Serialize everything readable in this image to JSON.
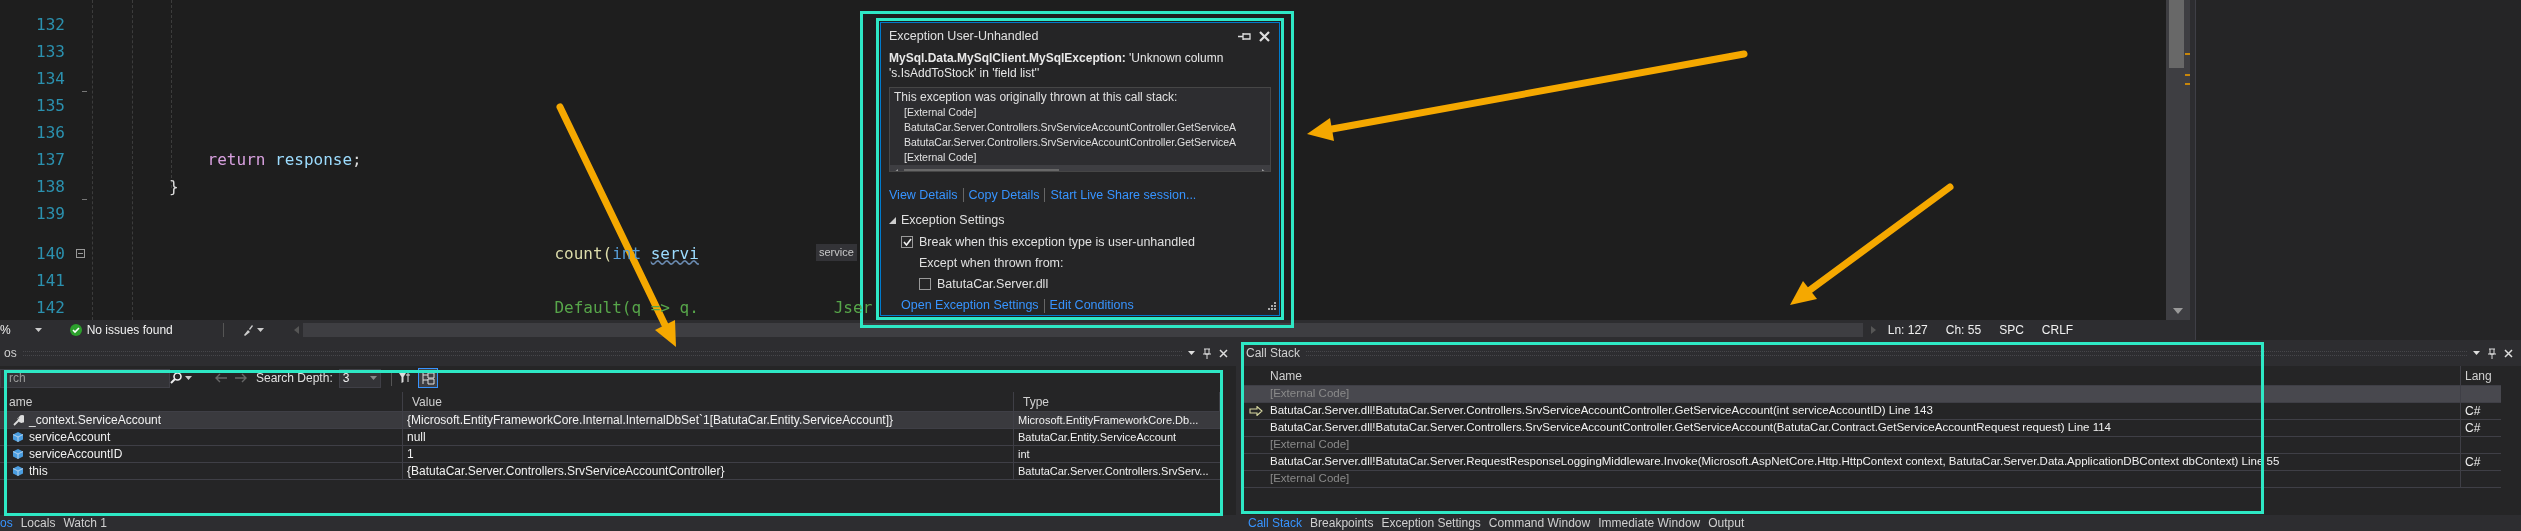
{
  "editor": {
    "lines": [
      {
        "number": "132",
        "kind": "plain"
      },
      {
        "number": "133",
        "kind": "plain"
      },
      {
        "number": "134",
        "kind": "fold_end"
      },
      {
        "number": "135",
        "kind": "plain"
      },
      {
        "number": "136",
        "kind": "plain"
      },
      {
        "number": "137",
        "kind": "plain",
        "tokens": [
          {
            "text": "            return",
            "kind": "control"
          },
          {
            "text": " response",
            "kind": "variable"
          },
          {
            "text": ";",
            "kind": "plain"
          }
        ]
      },
      {
        "number": "138",
        "kind": "fold_end",
        "tokens": [
          {
            "text": "        }",
            "kind": "plain"
          }
        ]
      },
      {
        "number": "139",
        "kind": "plain"
      },
      {
        "number": "140",
        "kind": "fold_start",
        "hint": "service",
        "tokens": [
          {
            "text": "                                                count(",
            "kind": "method"
          },
          {
            "text": "int ",
            "kind": "keyword"
          },
          {
            "text": "servi",
            "kind": "unresolved"
          }
        ]
      },
      {
        "number": "141",
        "kind": "plain"
      },
      {
        "number": "142",
        "kind": "plain",
        "tokens": [
          {
            "text": "                                                Default(q => q.              Jser",
            "kind": "comment"
          }
        ]
      }
    ]
  },
  "editor_status": {
    "zoom": "%",
    "issues": "No issues found",
    "position": [
      "Ln: 127",
      "Ch: 55",
      "SPC",
      "CRLF"
    ]
  },
  "exception_popup": {
    "title": "Exception User-Unhandled",
    "message": "**MySql.Data.MySqlClient.MySqlException:** 'Unknown column 's.IsAddToStock' in 'field list''",
    "stack_intro": "This exception was originally thrown at this call stack:",
    "stack": [
      "[External Code]",
      "BatutaCar.Server.Controllers.SrvServiceAccountController.GetServiceA",
      "BatutaCar.Server.Controllers.SrvServiceAccountController.GetServiceA",
      "[External Code]"
    ],
    "links": [
      "View Details",
      "Copy Details",
      "Start Live Share session..."
    ],
    "settings": {
      "title": "Exception Settings",
      "expanded": true,
      "break_option": {
        "label": "Break when this exception type is user-unhandled",
        "checked": true
      },
      "except_label": "Except when thrown from:",
      "modules": [
        {
          "label": "BatutaCar.Server.dll",
          "checked": false
        }
      ],
      "links": [
        "Open Exception Settings",
        "Edit Conditions"
      ]
    }
  },
  "autos_panel": {
    "title": "os",
    "search": {
      "placeholder": "rch"
    },
    "search_depth_label": "Search Depth:",
    "search_depth": "3",
    "columns": [
      "ame",
      "Value",
      "Type"
    ],
    "rows": [
      {
        "name": "_context.ServiceAccount",
        "value": "{Microsoft.EntityFrameworkCore.Internal.InternalDbSet`1[BatutaCar.Entity.ServiceAccount]}",
        "type": "Microsoft.EntityFrameworkCore.Db...",
        "kind": "property",
        "selected": true
      },
      {
        "name": "serviceAccount",
        "value": "null",
        "type": "BatutaCar.Entity.ServiceAccount",
        "kind": "local",
        "selected": false
      },
      {
        "name": "serviceAccountID",
        "value": "1",
        "type": "int",
        "kind": "local",
        "selected": false
      },
      {
        "name": "this",
        "value": "{BatutaCar.Server.Controllers.SrvServiceAccountController}",
        "type": "BatutaCar.Server.Controllers.SrvServ...",
        "kind": "local",
        "selected": false
      }
    ]
  },
  "call_stack_panel": {
    "title": "Call Stack",
    "columns": [
      "Name",
      "Lang"
    ],
    "rows": [
      {
        "name": "[External Code]",
        "kind": "external",
        "current": false,
        "selected": true
      },
      {
        "name": "BatutaCar.Server.dll!BatutaCar.Server.Controllers.SrvServiceAccountController.GetServiceAccount(int serviceAccountID) Line 143",
        "lang": "C#",
        "kind": "frame",
        "current": true,
        "selected": false
      },
      {
        "name": "BatutaCar.Server.dll!BatutaCar.Server.Controllers.SrvServiceAccountController.GetServiceAccount(BatutaCar.Contract.GetServiceAccountRequest request) Line 114",
        "lang": "C#",
        "kind": "frame",
        "current": false,
        "selected": false
      },
      {
        "name": "[External Code]",
        "kind": "external",
        "current": false,
        "selected": false
      },
      {
        "name": "BatutaCar.Server.dll!BatutaCar.Server.RequestResponseLoggingMiddleware.Invoke(Microsoft.AspNetCore.Http.HttpContext context, BatutaCar.Server.Data.ApplicationDBContext dbContext) Line 55",
        "lang": "C#",
        "kind": "frame",
        "current": false,
        "selected": false
      },
      {
        "name": "[External Code]",
        "kind": "external",
        "current": false,
        "selected": false
      }
    ]
  },
  "left_tabs": [
    {
      "label": "os",
      "selected": true
    },
    {
      "label": "Locals",
      "selected": false
    },
    {
      "label": "Watch 1",
      "selected": false
    }
  ],
  "right_tabs": [
    {
      "label": "Call Stack",
      "selected": true
    },
    {
      "label": "Breakpoints",
      "selected": false
    },
    {
      "label": "Exception Settings",
      "selected": false
    },
    {
      "label": "Command Window",
      "selected": false
    },
    {
      "label": "Immediate Window",
      "selected": false
    },
    {
      "label": "Output",
      "selected": false
    }
  ]
}
